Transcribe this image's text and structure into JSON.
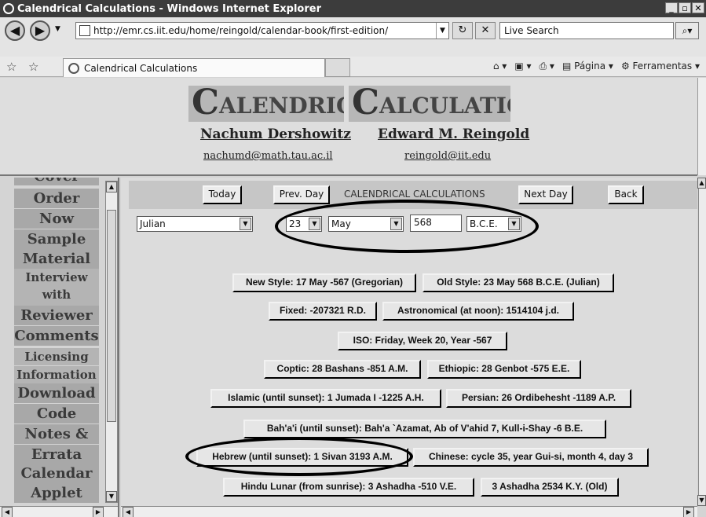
{
  "window": {
    "title": "Calendrical Calculations - Windows Internet Explorer",
    "controls": [
      "_",
      "▫",
      "✕"
    ]
  },
  "address_bar": {
    "url": "http://emr.cs.iit.edu/home/reingold/calendar-book/first-edition/",
    "search_placeholder": "Live Search"
  },
  "tab_row": {
    "tab_title": "Calendrical Calculations",
    "tools": {
      "page_label": "Página",
      "tools_label": "Ferramentas"
    }
  },
  "header": {
    "logo": {
      "word1_cap": "C",
      "word1_rest": "ALENDRICAL",
      "word2_cap": "C",
      "word2_rest": "ALCULATIONS"
    },
    "author1": "Nachum Dershowitz",
    "author2": "Edward M. Reingold",
    "email1": "nachumd@math.tau.ac.il",
    "email2": "reingold@iit.edu"
  },
  "sidebar": {
    "items": [
      {
        "label": "Cover"
      },
      {
        "label": "Order"
      },
      {
        "label": "Now"
      },
      {
        "label": "Sample"
      },
      {
        "label": "Material"
      },
      {
        "label": "Interview"
      },
      {
        "label": "with Authors"
      },
      {
        "label": "Reviewer"
      },
      {
        "label": "Comments"
      },
      {
        "label": "Licensing"
      },
      {
        "label": "Information"
      },
      {
        "label": "Download"
      },
      {
        "label": "Code"
      },
      {
        "label": "Notes &"
      },
      {
        "label": "Errata"
      },
      {
        "label": "Calendar"
      },
      {
        "label": "Applet"
      }
    ]
  },
  "toolbar": {
    "today": "Today",
    "prev_day": "Prev. Day",
    "page_title": "CALENDRICAL CALCULATIONS",
    "next_day": "Next Day",
    "back": "Back"
  },
  "date_input": {
    "calendar": "Julian",
    "day": "23",
    "month": "May",
    "year": "568",
    "era": "B.C.E."
  },
  "results": [
    "New Style: 17 May -567 (Gregorian)",
    "Old Style: 23 May 568 B.C.E. (Julian)",
    "Fixed: -207321 R.D.",
    "Astronomical (at noon): 1514104 j.d.",
    "ISO: Friday, Week 20, Year -567",
    "Coptic: 28 Bashans -851 A.M.",
    "Ethiopic: 28 Genbot -575 E.E.",
    "Islamic (until sunset): 1 Jumada I -1225 A.H.",
    "Persian: 26 Ordibehesht -1189 A.P.",
    "Bah'a'i (until sunset): Bah'a `Azamat, Ab of V'ahid 7, Kull-i-Shay -6 B.E.",
    "Hebrew (until sunset): 1 Sivan 3193 A.M.",
    "Chinese: cycle 35, year Gui-si, month 4, day 3",
    "Hindu Lunar (from sunrise): 3 Ashadha -510 V.E.",
    "3 Ashadha 2534 K.Y. (Old)"
  ]
}
